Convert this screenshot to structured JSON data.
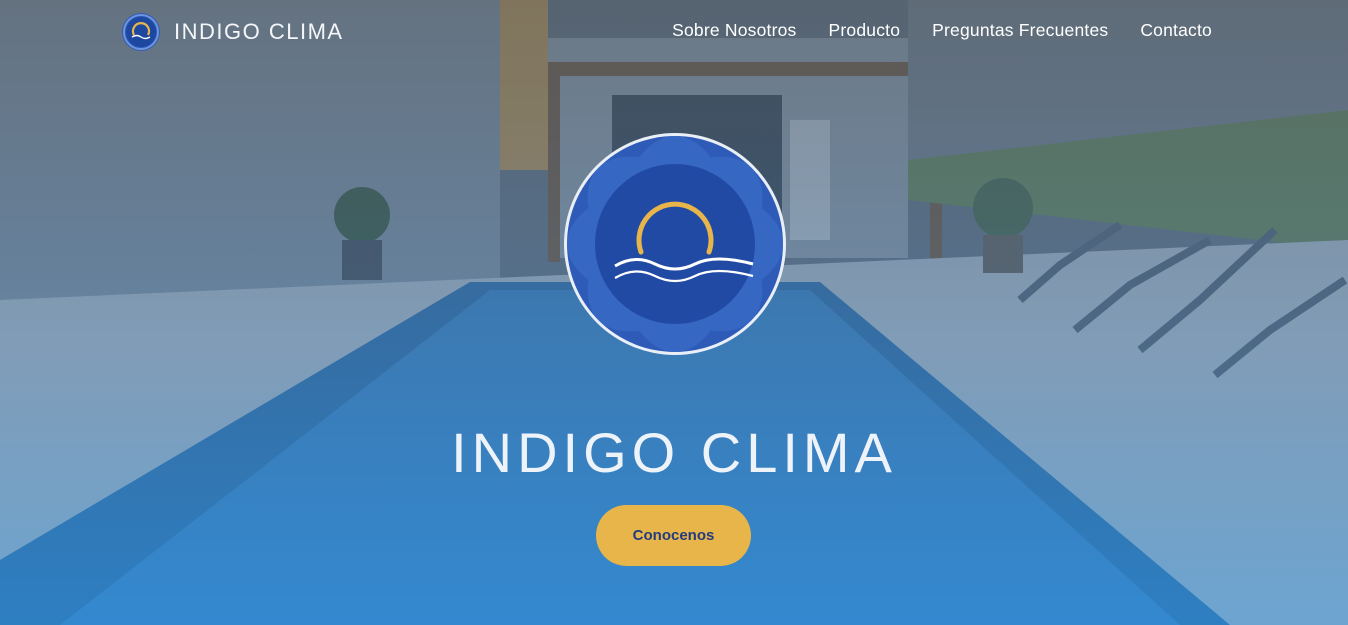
{
  "brand": {
    "name": "INDIGO CLIMA",
    "logo_icon": "indigo-clima-logo-icon"
  },
  "nav": {
    "items": [
      "Sobre Nosotros",
      "Producto",
      "Preguntas Frecuentes",
      "Contacto"
    ]
  },
  "hero": {
    "title": "INDIGO CLIMA",
    "cta_label": "Conocenos",
    "logo_icon": "sun-over-waves-logo-icon"
  },
  "colors": {
    "accent": "#e7b54a",
    "brand_blue": "#1f4aa3",
    "cta_text": "#243b7e"
  }
}
